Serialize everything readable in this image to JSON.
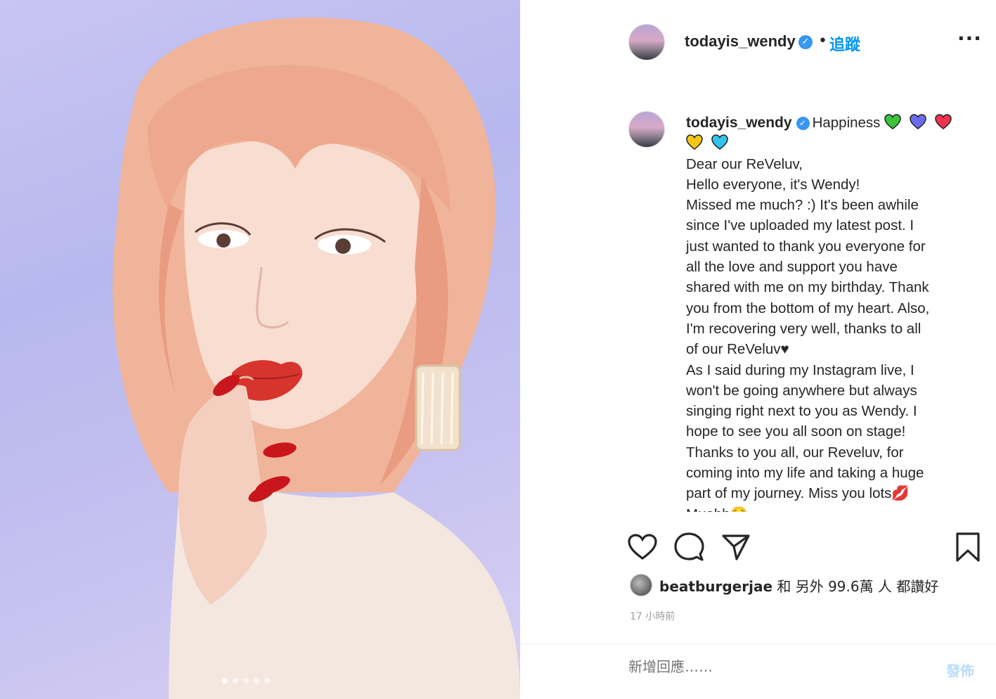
{
  "post": {
    "carousel_dots": 5,
    "carousel_active_index": 0
  },
  "header": {
    "username": "todayis_wendy",
    "separator": "•",
    "follow_label": "追蹤",
    "more_label": "···"
  },
  "caption": {
    "username": "todayis_wendy",
    "first_line_text": "Happiness",
    "hearts_line1": [
      "#3cc43c",
      "#6b6bf0",
      "#f0344d"
    ],
    "hearts_line2": [
      "#f5c518",
      "#33c4ee"
    ],
    "lines": [
      "Dear our ReVeluv,",
      "Hello everyone, it's Wendy!",
      "Missed me much? :) It's been awhile",
      "since I've uploaded my latest post. I",
      "just wanted to thank you everyone for",
      "all the love and support you have",
      "shared with me on my birthday. Thank",
      "you from the bottom of my heart. Also,",
      "I'm recovering very well, thanks to all",
      "of our ReVeluv♥",
      "As I said during my Instagram live, I",
      "won't be going anywhere but always",
      "singing right next to you as Wendy. I",
      "hope to see you all soon on stage!",
      "Thanks to you all, our Reveluv, for",
      "coming into my life and taking a huge",
      "part of my journey. Miss you lots💋",
      "Muahh🥺"
    ]
  },
  "actions": {
    "like_icon": "heart-icon",
    "comment_icon": "comment-icon",
    "share_icon": "share-icon",
    "save_icon": "bookmark-icon"
  },
  "likes": {
    "user": "beatburgerjae",
    "rest": " 和 另外 99.6萬 人 都讚好"
  },
  "timestamp": "17 小時前",
  "comment": {
    "placeholder": "新增回應……",
    "post_label": "發佈"
  }
}
